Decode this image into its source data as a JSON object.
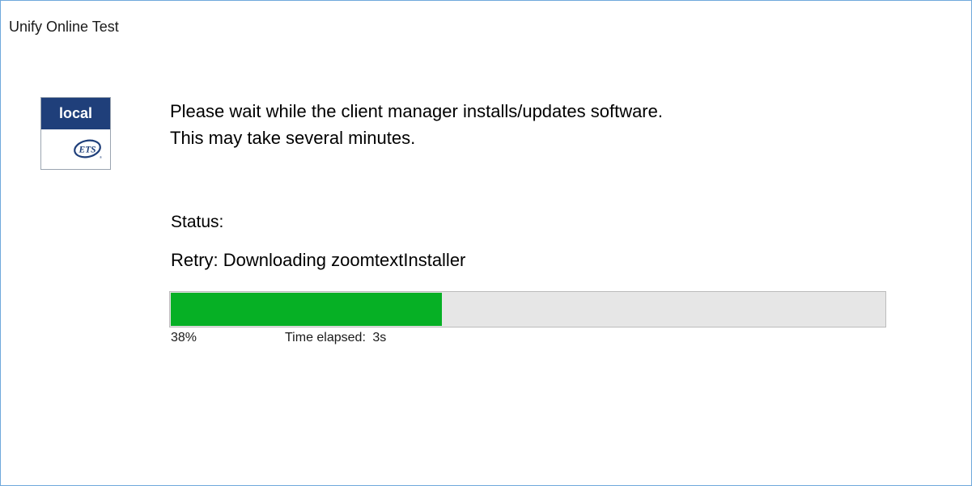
{
  "window": {
    "title": "Unify Online Test"
  },
  "logo": {
    "label": "local",
    "mark_icon": "ets-logo-icon",
    "brand_color": "#1f3f7a"
  },
  "message": {
    "line1": "Please wait while the client manager installs/updates software.",
    "line2": "This may take several minutes."
  },
  "status": {
    "label": "Status:",
    "text": "Retry: Downloading zoomtextInstaller"
  },
  "progress": {
    "value": 0.38,
    "percent_text": "38%",
    "fill_color": "#06b025",
    "elapsed_label": "Time elapsed:",
    "elapsed_value": "3s"
  }
}
